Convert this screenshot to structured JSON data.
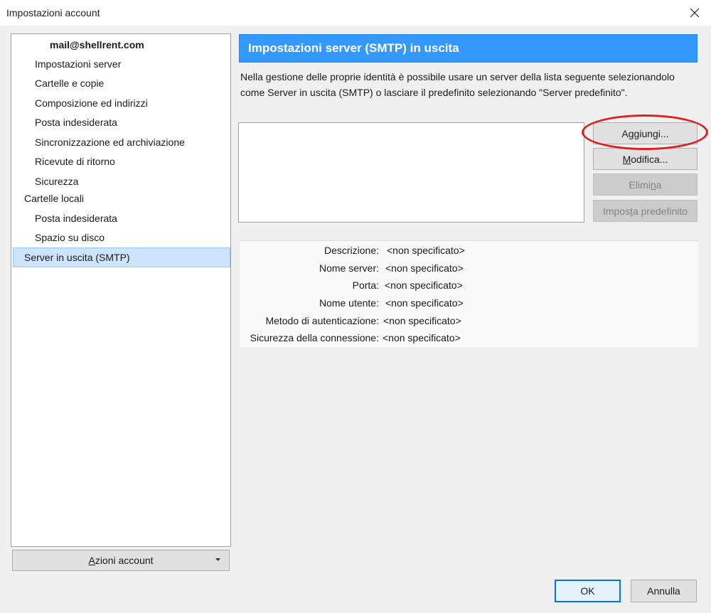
{
  "window": {
    "title": "Impostazioni account"
  },
  "tree": {
    "items": [
      {
        "label": "mail@shellrent.com",
        "level": 0,
        "expanded": true
      },
      {
        "label": "Impostazioni server",
        "level": 1
      },
      {
        "label": "Cartelle e copie",
        "level": 1
      },
      {
        "label": "Composizione ed indirizzi",
        "level": 1
      },
      {
        "label": "Posta indesiderata",
        "level": 1
      },
      {
        "label": "Sincronizzazione ed archiviazione",
        "level": 1
      },
      {
        "label": "Ricevute di ritorno",
        "level": 1
      },
      {
        "label": "Sicurezza",
        "level": 1
      },
      {
        "label": "Cartelle locali",
        "level": 0,
        "expanded": true
      },
      {
        "label": "Posta indesiderata",
        "level": 1
      },
      {
        "label": "Spazio su disco",
        "level": 1
      },
      {
        "label": "Server in uscita (SMTP)",
        "level": 0,
        "selected": true
      }
    ]
  },
  "account_actions": {
    "label_prefix": "",
    "label_underlined": "A",
    "label_rest": "zioni account"
  },
  "panel": {
    "header": "Impostazioni server (SMTP) in uscita",
    "description": "Nella gestione delle proprie identità è possibile usare un server della lista seguente selezionandolo come Server in uscita (SMTP) o lasciare il predefinito selezionando \"Server predefinito\".",
    "buttons": {
      "add": {
        "pre": "A",
        "u": "g",
        "post": "giungi..."
      },
      "edit": {
        "pre": "",
        "u": "M",
        "post": "odifica..."
      },
      "delete": {
        "pre": "Elimi",
        "u": "n",
        "post": "a"
      },
      "set_default": {
        "pre": "Impos",
        "u": "t",
        "post": "a predefinito"
      }
    }
  },
  "details": [
    {
      "label": "Descrizione:",
      "value": "<non specificato>"
    },
    {
      "label": "Nome server:",
      "value": "<non specificato>"
    },
    {
      "label": "Porta:",
      "value": "<non specificato>"
    },
    {
      "label": "Nome utente:",
      "value": "<non specificato>"
    },
    {
      "label": "Metodo di autenticazione:",
      "value": "<non specificato>"
    },
    {
      "label": "Sicurezza della connessione:",
      "value": "<non specificato>"
    }
  ],
  "footer": {
    "ok": "OK",
    "cancel": "Annulla"
  },
  "colors": {
    "header_bg": "#3399ff",
    "selection_bg": "#cce4fc",
    "highlight_ellipse": "#e02020"
  },
  "icons": {
    "close": "close-icon",
    "twisty": "expanded-triangle-icon",
    "dropdown": "dropdown-arrow-icon"
  }
}
